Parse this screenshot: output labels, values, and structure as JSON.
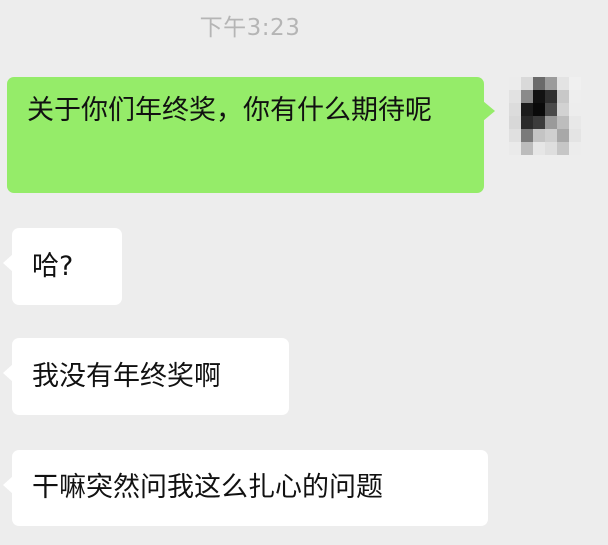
{
  "chat": {
    "timestamp": "下午3:23",
    "messages": [
      {
        "side": "sent",
        "text": "关于你们年终奖，你有什么期待呢"
      },
      {
        "side": "received",
        "text": "哈?"
      },
      {
        "side": "received",
        "text": "我没有年终奖啊"
      },
      {
        "side": "received",
        "text": "干嘛突然问我这么扎心的问题"
      }
    ],
    "avatar": {
      "icon": "pixelated-avatar-icon"
    }
  },
  "colors": {
    "background": "#ededed",
    "sent_bubble": "#95ec69",
    "received_bubble": "#ffffff",
    "timestamp_text": "#b5b5b5"
  }
}
